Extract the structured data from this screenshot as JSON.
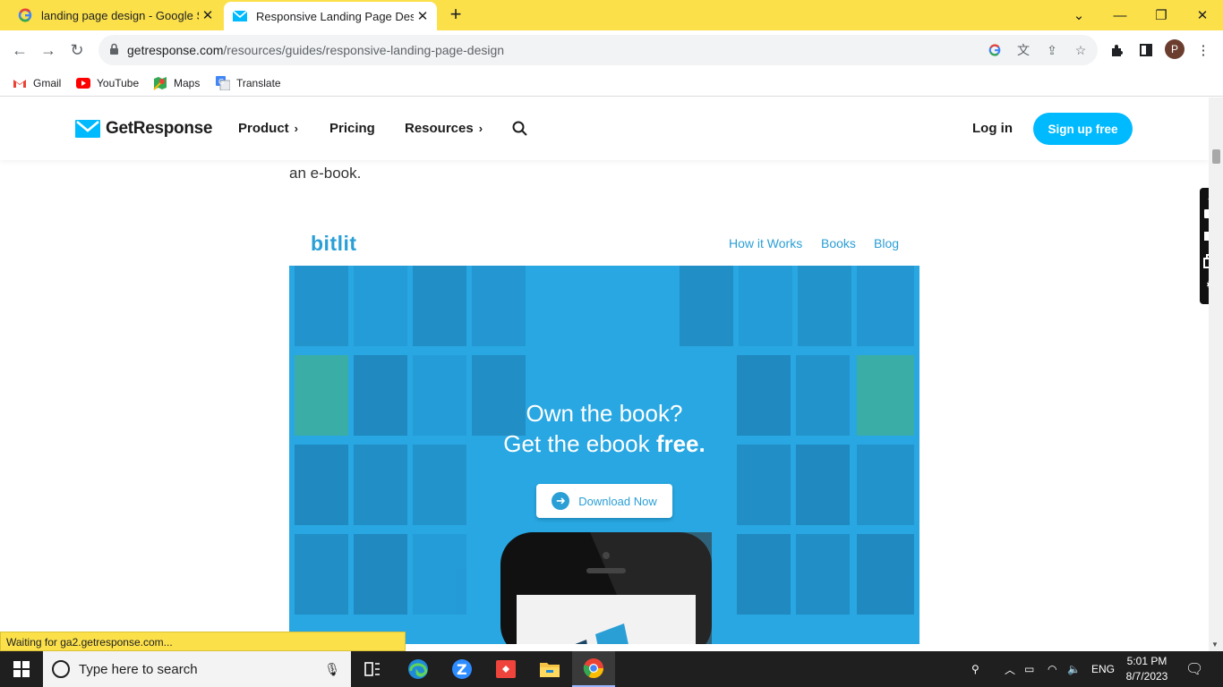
{
  "browser": {
    "tabs": [
      {
        "title": "landing page design - Google Se",
        "active": false
      },
      {
        "title": "Responsive Landing Page Design",
        "active": true
      }
    ],
    "url_domain": "getresponse.com",
    "url_path": "/resources/guides/responsive-landing-page-design",
    "profile_initial": "P",
    "bookmarks": [
      {
        "label": "Gmail"
      },
      {
        "label": "YouTube"
      },
      {
        "label": "Maps"
      },
      {
        "label": "Translate"
      }
    ],
    "status_text": "Waiting for ga2.getresponse.com..."
  },
  "site": {
    "logo_text": "GetResponse",
    "nav": {
      "product": "Product",
      "pricing": "Pricing",
      "resources": "Resources"
    },
    "login": "Log in",
    "signup": "Sign up free",
    "body_text": "an e-book.",
    "colors": {
      "brand": "#00baff",
      "bitlit_blue": "#2a9fd6"
    }
  },
  "example": {
    "logo": "bitlit",
    "nav": [
      "How it Works",
      "Books",
      "Blog"
    ],
    "headline_line1": "Own the book?",
    "headline_line2_prefix": "Get the ebook ",
    "headline_line2_bold": "free.",
    "button": "Download Now"
  },
  "taskbar": {
    "search_placeholder": "Type here to search",
    "lang": "ENG",
    "time": "5:01 PM",
    "date": "8/7/2023"
  }
}
